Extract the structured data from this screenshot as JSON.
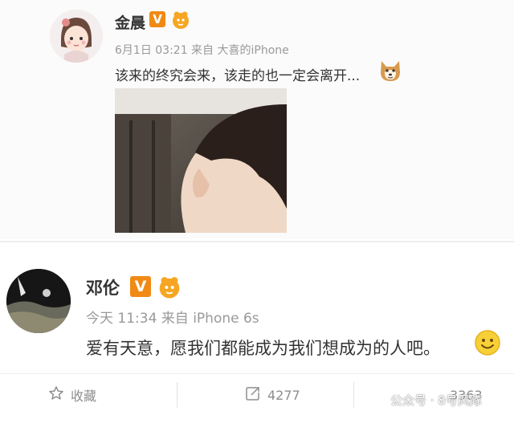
{
  "post1": {
    "username": "金晨",
    "verified_badge": "V",
    "meta": "6月1日 03:21 来自 大喜的iPhone",
    "content": "该来的终究会来，该走的也一定会离开...",
    "emoji": "shiba-dog-emoji",
    "image": "photo-of-person-looking-down"
  },
  "post2": {
    "username": "邓伦",
    "verified_badge": "V",
    "meta": "今天 11:34 来自 iPhone 6s",
    "content": "爱有天意，愿我们都能成为我们想成为的人吧。",
    "emoji": "smile-emoji"
  },
  "actions": {
    "favorite_label": "收藏",
    "repost_count": "4277",
    "comment_count": "3363"
  },
  "watermark": {
    "text": "公众号 · 8号风隊"
  },
  "colors": {
    "verified_orange": "#f08a14",
    "meta_gray": "#999999",
    "action_gray": "#8d8d8d"
  }
}
